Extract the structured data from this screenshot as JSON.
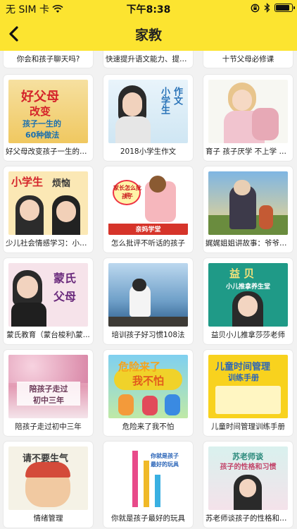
{
  "status_bar": {
    "carrier": "无 SIM 卡",
    "time": "下午8:38"
  },
  "nav": {
    "title": "家教"
  },
  "rows": [
    {
      "items": [
        "你会和孩子聊天吗?",
        "快速提升语文能力、提高...",
        "十节父母必修课"
      ]
    },
    {
      "items": [
        "好父母改变孩子一生的6...",
        "2018小学生作文",
        "育子 孩子厌学 不上学 学..."
      ]
    },
    {
      "items": [
        "少儿社会情感学习：小学...",
        "怎么批评不听话的孩子",
        "娓娓姐姐讲故事：爷爷一..."
      ]
    },
    {
      "items": [
        "蒙氏教育（蒙台梭利\\蒙...",
        "培训孩子好习惯108法",
        "益贝小儿推拿莎莎老师"
      ]
    },
    {
      "items": [
        "陪孩子走过初中三年",
        "危险来了我不怕",
        "儿童时间管理训练手册"
      ]
    },
    {
      "items": [
        "情绪管理",
        "你就是孩子最好的玩具",
        "苏老师谈孩子的性格和习..."
      ]
    }
  ],
  "thumb_text": {
    "r1c0": [
      "好父母",
      "改变",
      "孩子一生的",
      "60种做法"
    ],
    "r1c1": [
      "小学生",
      "作文"
    ],
    "r2c0": [
      "小学生",
      "烦恼"
    ],
    "r2c1": [
      "家长怎么批评",
      "孩子",
      "亲妈学堂"
    ],
    "r3c0": [
      "蒙氏",
      "父母"
    ],
    "r3c2": [
      "益 贝",
      "小儿推拿养生堂"
    ],
    "r4c0": [
      "陪孩子走过",
      "初中三年"
    ],
    "r4c1": [
      "危险来了",
      "我不怕"
    ],
    "r4c2": [
      "儿童时间管理",
      "训练手册"
    ],
    "r5c0": [
      "请不要生气"
    ],
    "r5c1": [
      "你就是孩子",
      "最好的玩具"
    ],
    "r5c2": [
      "苏老师谈",
      "孩子的性格和习惯"
    ]
  },
  "colors": {
    "accent": "#fce430",
    "background": "#f2f2f2"
  }
}
